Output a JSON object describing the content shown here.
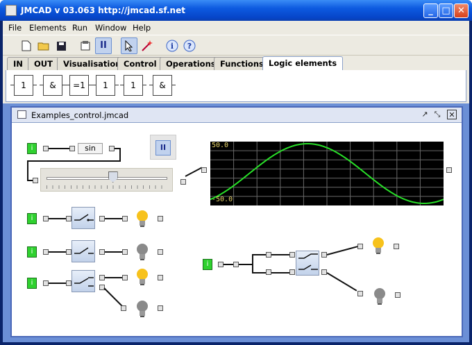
{
  "window": {
    "title": "JMCAD v 03.063 http://jmcad.sf.net",
    "min_glyph": "_",
    "max_glyph": "□",
    "close_glyph": "✕"
  },
  "menu": [
    "File",
    "Elements",
    "Run",
    "Window",
    "Help"
  ],
  "toolbar": {
    "icons": [
      "new-icon",
      "open-icon",
      "save-icon",
      "properties-icon",
      "pause-icon",
      "select-arrow-icon",
      "edit-wand-icon",
      "info-icon",
      "help-icon"
    ]
  },
  "tabs": [
    "IN",
    "OUT",
    "Visualisation",
    "Control",
    "Operations",
    "Functions",
    "Logic elements"
  ],
  "selected_tab": "Logic elements",
  "palette": [
    "1",
    "&",
    "=1",
    "1",
    "1",
    "&"
  ],
  "inner_window": {
    "title": "Examples_control.jmcad",
    "buttons": [
      "↗",
      "⤡",
      "✕"
    ]
  },
  "canvas": {
    "source_label": "i",
    "sin_label": "sin",
    "pause_symbol": "II",
    "slider_value": 0.55,
    "scope": {
      "ymax": "50.0",
      "ymin": "-50.0"
    },
    "bulbs": [
      "on",
      "off",
      "on",
      "off",
      "on",
      "off"
    ]
  },
  "colors": {
    "source": "#2fd12f",
    "wave": "#28e028",
    "bulb_on": "#f7c21c",
    "bulb_off": "#8a8a8a"
  }
}
